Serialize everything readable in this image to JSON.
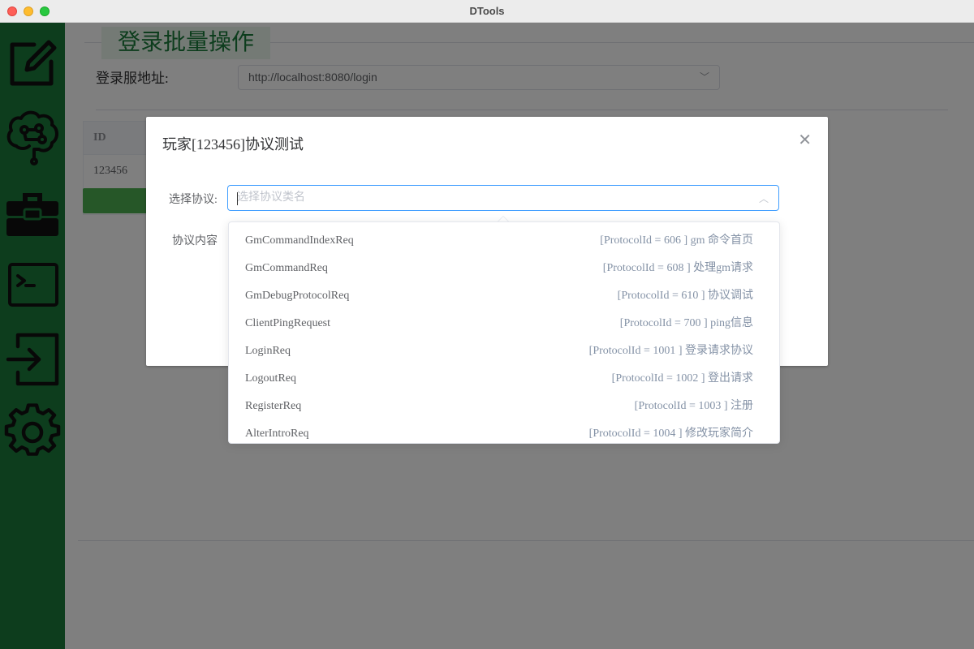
{
  "window": {
    "title": "DTools"
  },
  "sidebar": {
    "icons": [
      "edit-icon",
      "brain-icon",
      "toolbox-icon",
      "terminal-icon",
      "login-icon",
      "settings-icon"
    ]
  },
  "main": {
    "heading": "登录批量操作",
    "login_server_label": "登录服地址:",
    "login_server_value": "http://localhost:8080/login",
    "table": {
      "header": "ID",
      "rows": [
        "123456"
      ]
    }
  },
  "dialog": {
    "title": "玩家[123456]协议测试",
    "protocol_label": "选择协议:",
    "protocol_placeholder": "选择协议类名",
    "content_label": "协议内容"
  },
  "dropdown": {
    "options": [
      {
        "name": "GmCommandIndexReq",
        "desc": "[ProtocolId = 606 ] gm 命令首页"
      },
      {
        "name": "GmCommandReq",
        "desc": "[ProtocolId = 608 ] 处理gm请求"
      },
      {
        "name": "GmDebugProtocolReq",
        "desc": "[ProtocolId = 610 ] 协议调试"
      },
      {
        "name": "ClientPingRequest",
        "desc": "[ProtocolId = 700 ] ping信息"
      },
      {
        "name": "LoginReq",
        "desc": "[ProtocolId = 1001 ] 登录请求协议"
      },
      {
        "name": "LogoutReq",
        "desc": "[ProtocolId = 1002 ] 登出请求"
      },
      {
        "name": "RegisterReq",
        "desc": "[ProtocolId = 1003 ] 注册"
      },
      {
        "name": "AlterIntroReq",
        "desc": "[ProtocolId = 1004 ] 修改玩家简介"
      }
    ]
  },
  "colors": {
    "sidebar": "#1b7a3a",
    "accent": "#409eff",
    "button": "#4caf50"
  }
}
